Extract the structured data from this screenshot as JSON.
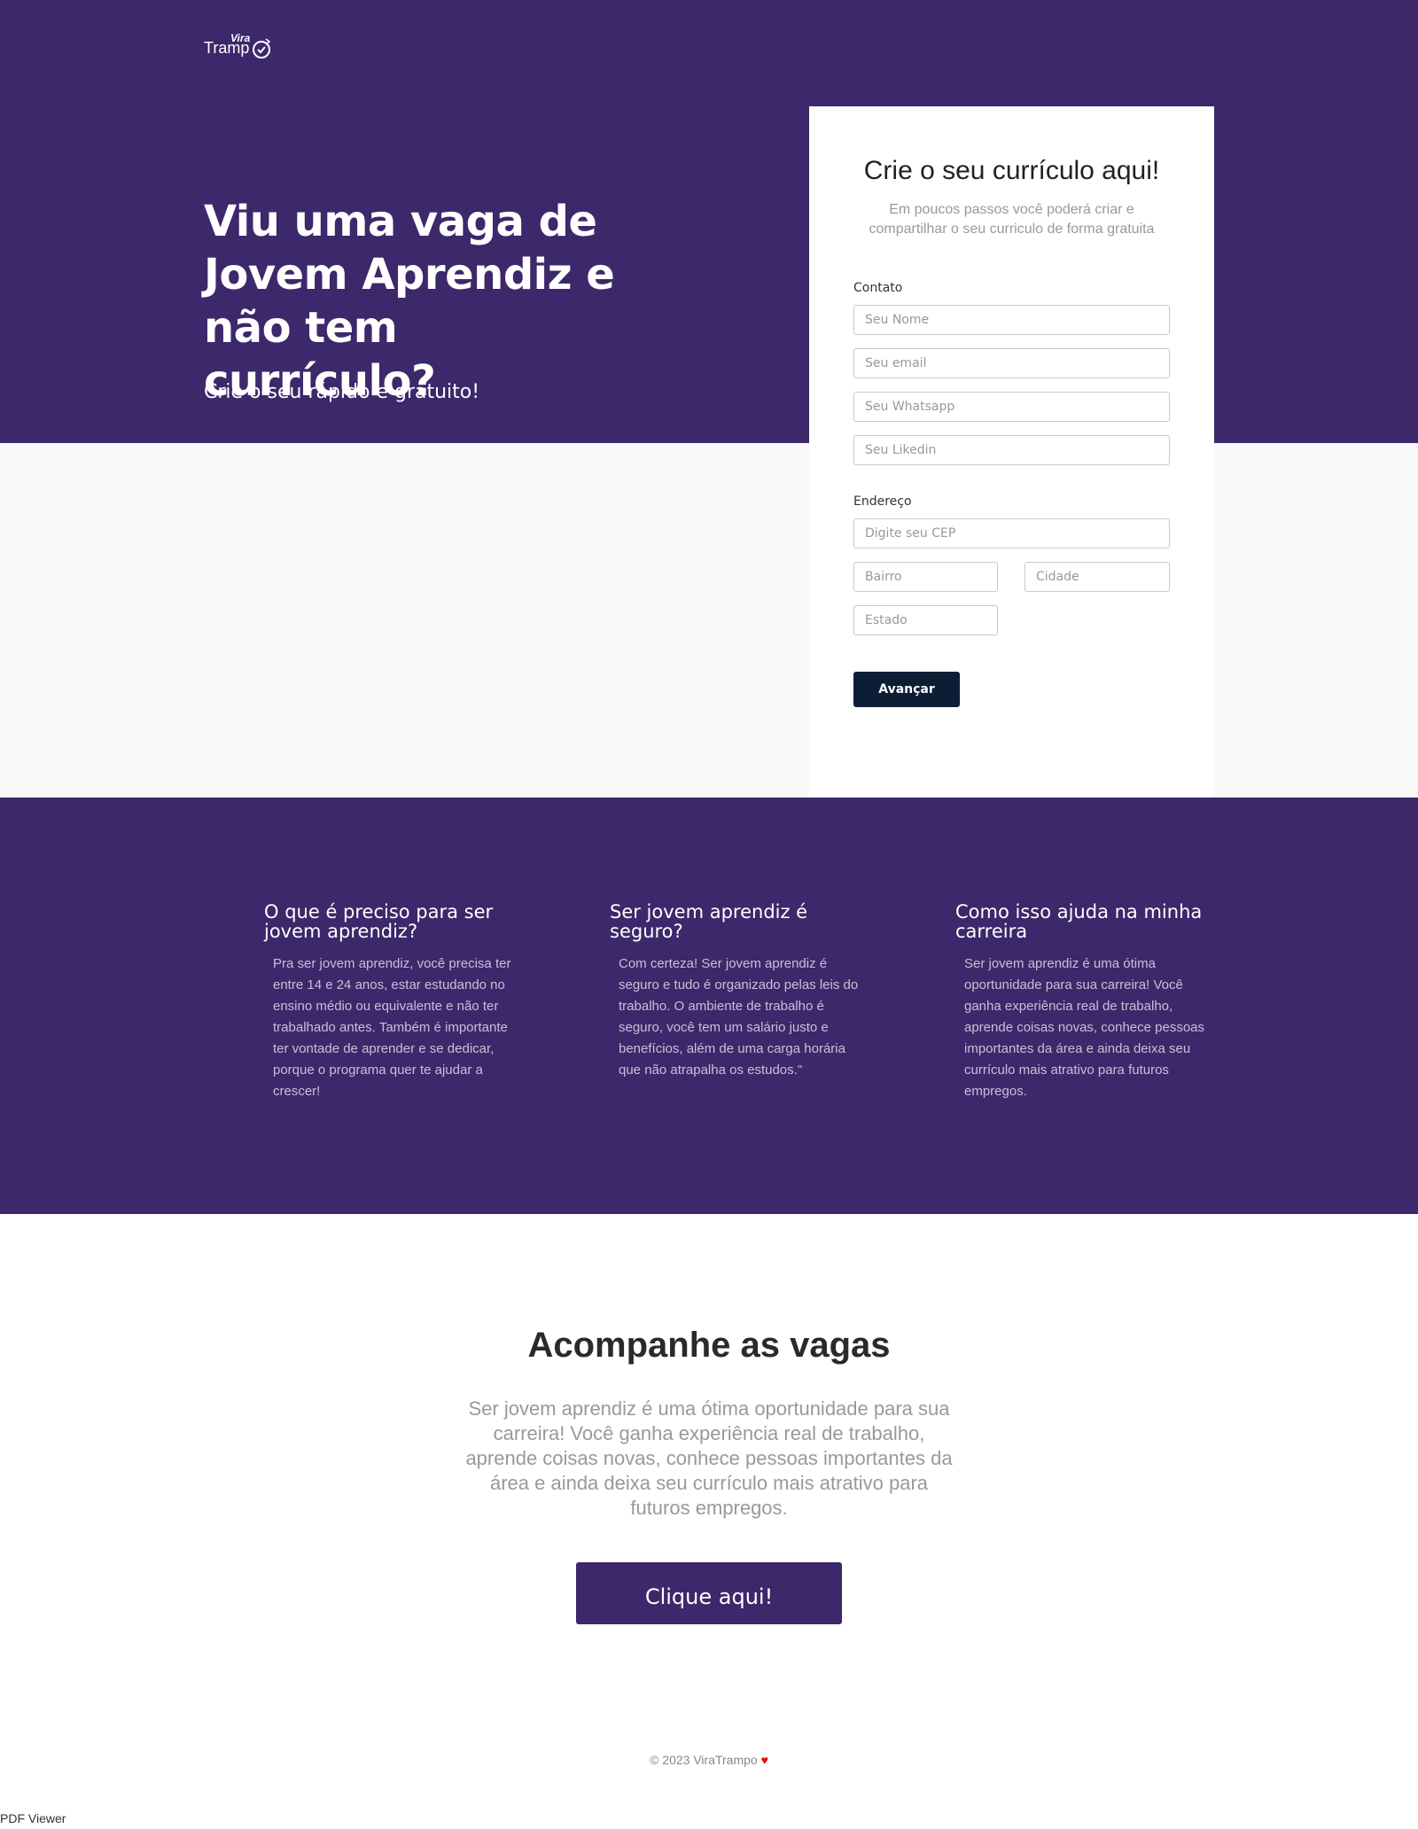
{
  "logo": {
    "top_text": "Vira",
    "main_text": "Tramp"
  },
  "hero": {
    "title": "Viu uma vaga de Jovem Aprendiz e não tem currículo?",
    "subtitle": "Crie o seu rápido e gratuito!"
  },
  "form": {
    "title": "Crie o seu currículo aqui!",
    "description": "Em poucos passos você poderá criar e compartilhar o seu curriculo de forma gratuita",
    "contact_label": "Contato",
    "name_placeholder": "Seu Nome",
    "email_placeholder": "Seu email",
    "whatsapp_placeholder": "Seu Whatsapp",
    "linkedin_placeholder": "Seu Likedin",
    "address_label": "Endereço",
    "cep_placeholder": "Digite seu CEP",
    "bairro_placeholder": "Bairro",
    "cidade_placeholder": "Cidade",
    "estado_placeholder": "Estado",
    "submit_label": "Avançar"
  },
  "info": [
    {
      "title": "O que é preciso para ser jovem aprendiz?",
      "text": "Pra ser jovem aprendiz, você precisa ter entre 14 e 24 anos, estar estudando no ensino médio ou equivalente e não ter trabalhado antes. Também é importante ter vontade de aprender e se dedicar, porque o programa quer te ajudar a crescer!"
    },
    {
      "title": "Ser jovem aprendiz é seguro?",
      "text": "Com certeza! Ser jovem aprendiz é seguro e tudo é organizado pelas leis do trabalho. O ambiente de trabalho é seguro, você tem um salário justo e benefícios, além de uma carga horária que não atrapalha os estudos.\""
    },
    {
      "title": "Como isso ajuda na minha carreira",
      "text": "Ser jovem aprendiz é uma ótima oportunidade para sua carreira! Você ganha experiência real de trabalho, aprende coisas novas, conhece pessoas importantes da área e ainda deixa seu currículo mais atrativo para futuros empregos."
    }
  ],
  "vagas": {
    "title": "Acompanhe as vagas",
    "text": "Ser jovem aprendiz é uma ótima oportunidade para sua carreira! Você ganha experiência real de trabalho, aprende coisas novas, conhece pessoas importantes da área e ainda deixa seu currículo mais atrativo para futuros empregos.",
    "button_label": "Clique aqui!"
  },
  "footer": {
    "text": "© 2023 ViraTrampo",
    "heart": "♥"
  },
  "pdf_viewer_alt": "PDF Viewer",
  "colors": {
    "brand_purple": "#3c286a",
    "button_dark": "#0c1e35",
    "heart_red": "#ee0000"
  }
}
